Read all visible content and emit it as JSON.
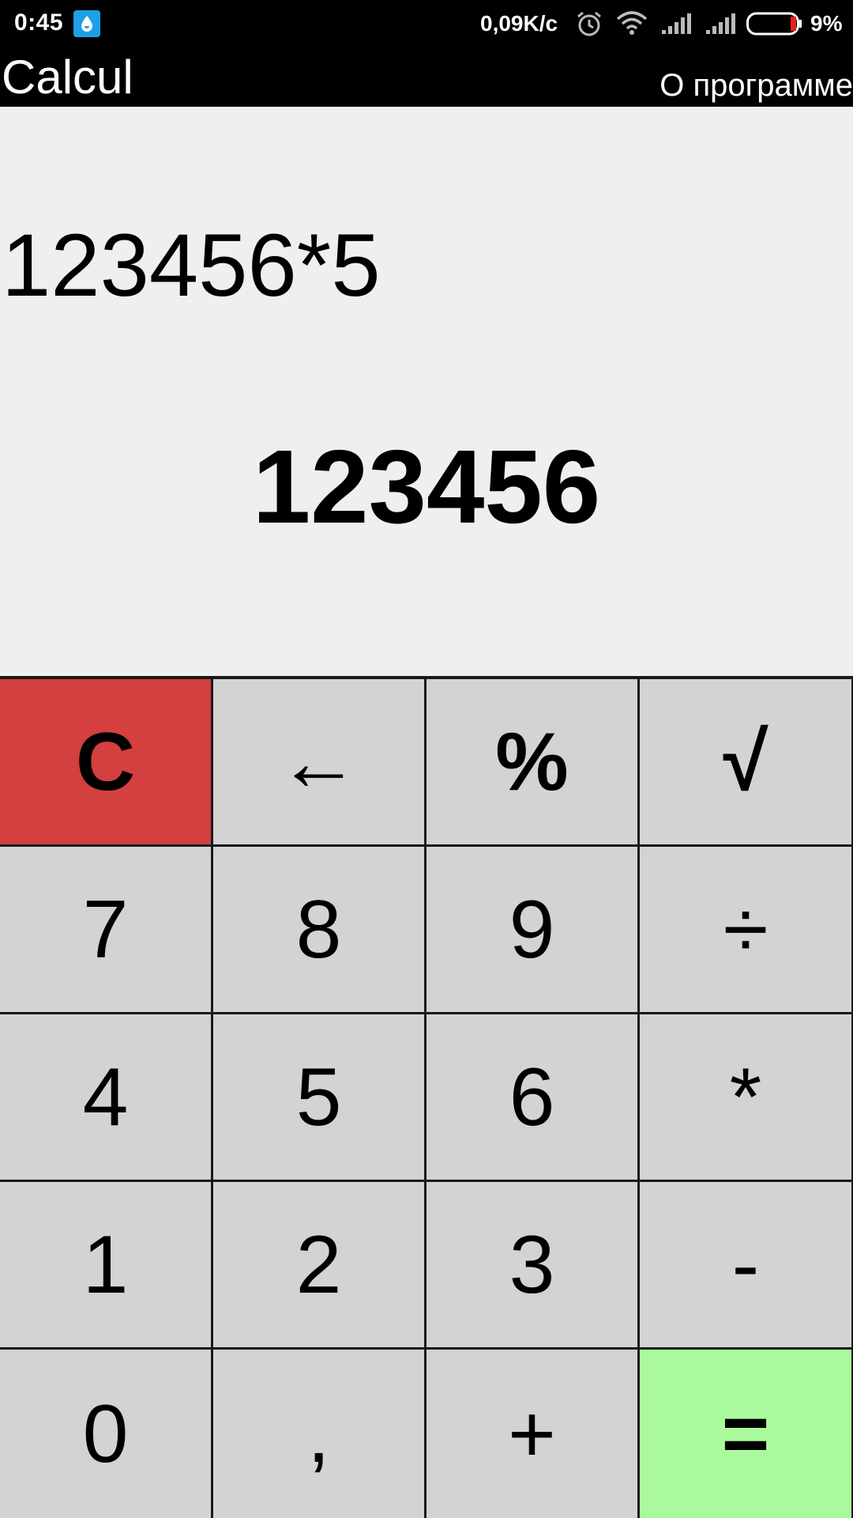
{
  "status_bar": {
    "time": "0:45",
    "net_speed": "0,09K/c",
    "battery_percent": "9%",
    "battery_level": 0.09,
    "icons": [
      "drop-icon",
      "alarm-icon",
      "wifi-icon",
      "signal-icon",
      "signal-icon",
      "battery-icon"
    ]
  },
  "app_bar": {
    "title": "Calcul",
    "about_label": "О программе"
  },
  "display": {
    "expression": "123456*5",
    "result": "123456"
  },
  "keys": {
    "clear": "C",
    "backspace": "←",
    "percent": "%",
    "sqrt": "√",
    "seven": "7",
    "eight": "8",
    "nine": "9",
    "divide": "÷",
    "four": "4",
    "five": "5",
    "six": "6",
    "multiply": "*",
    "one": "1",
    "two": "2",
    "three": "3",
    "minus": "-",
    "zero": "0",
    "comma": ",",
    "plus": "+",
    "equals": "="
  },
  "colors": {
    "clear_key": "#d43f3f",
    "equals_key": "#aaf99c",
    "key": "#d3d3d3",
    "display_bg": "#efefef",
    "bar_bg": "#000000"
  }
}
